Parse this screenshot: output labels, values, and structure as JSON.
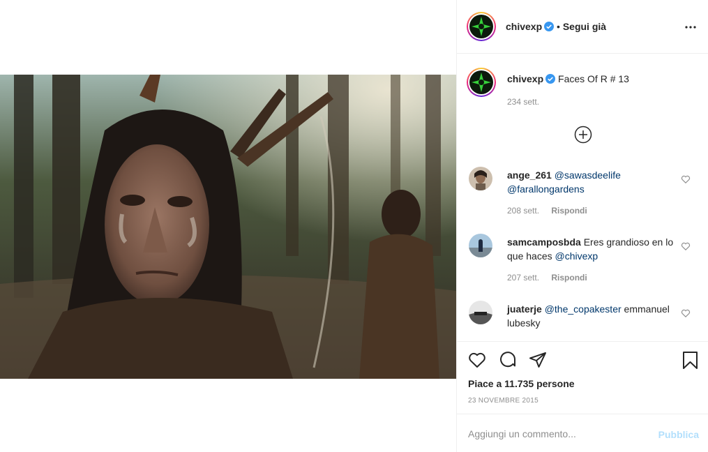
{
  "post": {
    "username": "chivexp",
    "verified": true,
    "follow_state": "Segui già",
    "separator": "•",
    "caption": "Faces Of R # 13",
    "caption_time": "234 sett.",
    "image_alt": "Portrait of a man with long dark hair and feathers in a forest",
    "likes_text": "Piace a 11.735 persone",
    "date": "23 NOVEMBRE 2015"
  },
  "icons": {
    "more": "more-options-icon",
    "load_more": "plus-circle-icon",
    "like": "heart-icon",
    "comment": "comment-bubble-icon",
    "share": "paper-plane-icon",
    "save": "bookmark-icon",
    "comment_like": "small-heart-icon"
  },
  "comments": [
    {
      "user": "ange_261",
      "mentions": [
        "@sawasdeelife",
        "@farallongardens"
      ],
      "text": "",
      "time": "208 sett.",
      "reply": "Rispondi"
    },
    {
      "user": "samcamposbda",
      "mentions": [
        "@chivexp"
      ],
      "text": "Eres grandioso en lo que haces",
      "time": "207 sett.",
      "reply": "Rispondi"
    },
    {
      "user": "juaterje",
      "mentions": [
        "@the_copakester"
      ],
      "text": "emmanuel lubesky",
      "time": "",
      "reply": ""
    }
  ],
  "add_comment": {
    "placeholder": "Aggiungi un commento...",
    "publish_label": "Pubblica"
  },
  "colors": {
    "verified_blue": "#3897f0",
    "link_blue": "#00376b",
    "publish_disabled": "#b2dffc",
    "muted": "#8e8e8e"
  }
}
